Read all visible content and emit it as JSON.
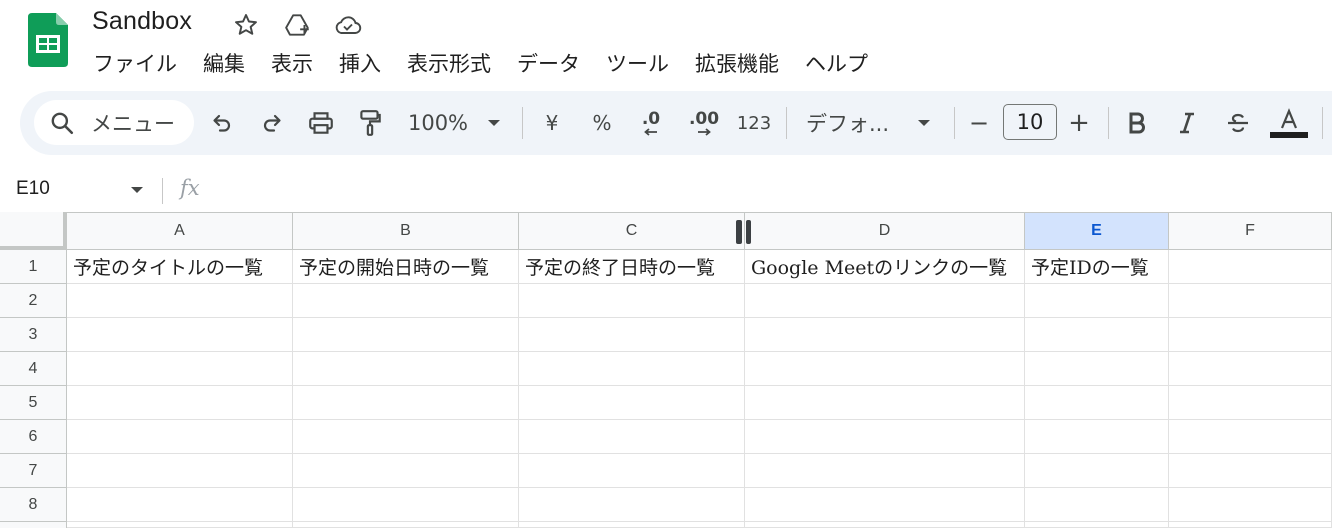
{
  "doc": {
    "title": "Sandbox"
  },
  "colors": {
    "sheets_green": "#0f9d58",
    "selected_header_bg": "#d3e3fd",
    "selected_header_text": "#0b57d0",
    "toolbar_bg": "#f0f4f9"
  },
  "title_icons": [
    "star-icon",
    "move-to-drive-icon",
    "cloud-saved-icon"
  ],
  "menu": [
    {
      "label": "ファイル"
    },
    {
      "label": "編集"
    },
    {
      "label": "表示"
    },
    {
      "label": "挿入"
    },
    {
      "label": "表示形式"
    },
    {
      "label": "データ"
    },
    {
      "label": "ツール"
    },
    {
      "label": "拡張機能"
    },
    {
      "label": "ヘルプ"
    }
  ],
  "toolbar": {
    "search_label": "メニュー",
    "zoom": "100%",
    "currency": "¥",
    "percent": "%",
    "decrease_decimal": ".0",
    "increase_decimal": ".00",
    "more_formats": "123",
    "font_name": "デフォ...",
    "font_size": "10",
    "minus": "−",
    "plus": "+"
  },
  "formula_bar": {
    "cell_ref": "E10",
    "fx": "fx"
  },
  "grid": {
    "columns": [
      "A",
      "B",
      "C",
      "D",
      "E",
      "F"
    ],
    "selected_column": "E",
    "rows": [
      "1",
      "2",
      "3",
      "4",
      "5",
      "6",
      "7",
      "8"
    ],
    "cells": {
      "A1": "予定のタイトルの一覧",
      "B1": "予定の開始日時の一覧",
      "C1": "予定の終了日時の一覧",
      "D1": "Google Meetのリンクの一覧",
      "E1": "予定IDの一覧"
    }
  }
}
